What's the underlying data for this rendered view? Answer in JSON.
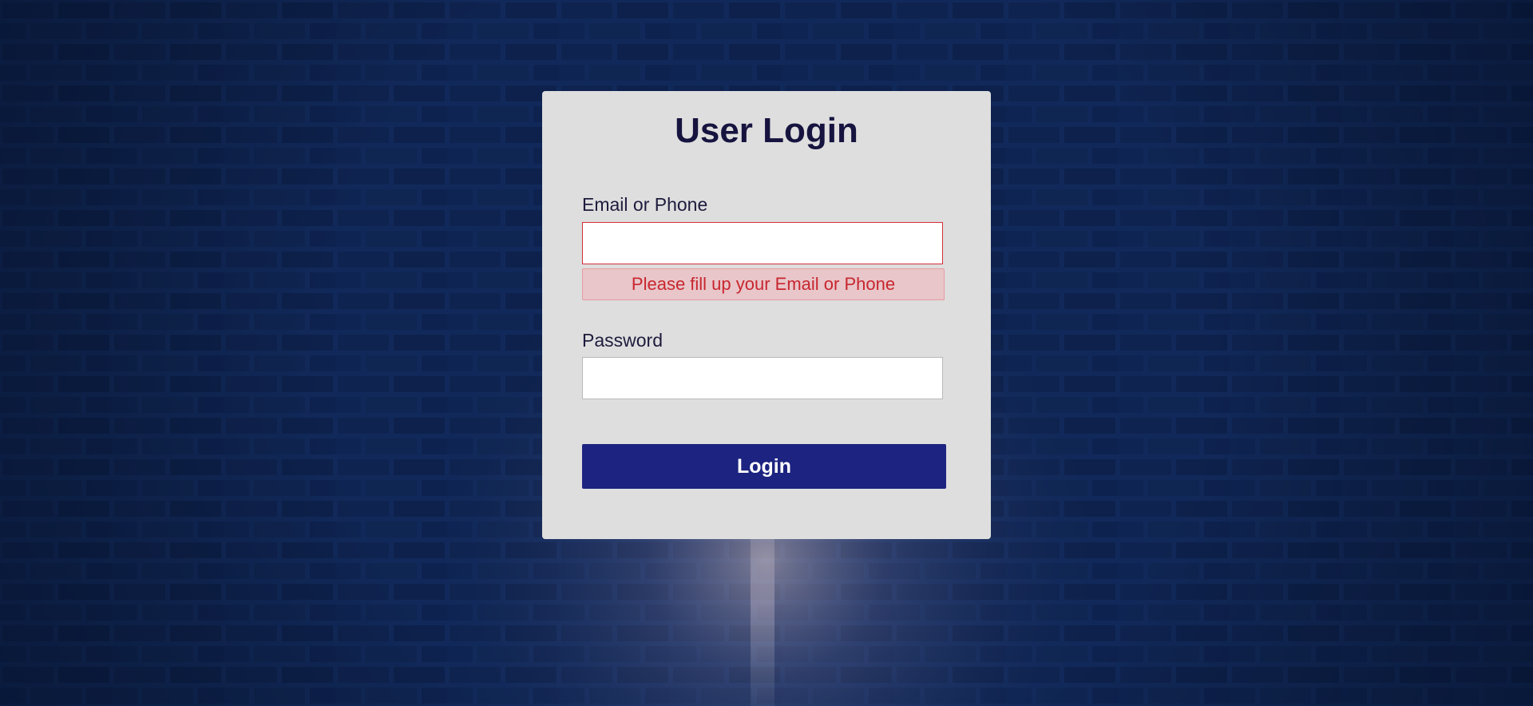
{
  "background": {
    "image": "blue-brick-wall",
    "base_color": "#0e2654",
    "mortar_color": "#27457e",
    "light_color": "#c9b9c4"
  },
  "login_card": {
    "title": "User Login",
    "background_color": "#dedede",
    "email_field": {
      "label": "Email or Phone",
      "value": "",
      "placeholder": "",
      "border_color": "#d32f3a"
    },
    "email_error": {
      "message": "Please fill up your Email or Phone",
      "text_color": "#c8262f",
      "background_color": "#e8c6c9"
    },
    "password_field": {
      "label": "Password",
      "value": "",
      "placeholder": ""
    },
    "login_button": {
      "label": "Login",
      "color": "#1c2380"
    }
  }
}
